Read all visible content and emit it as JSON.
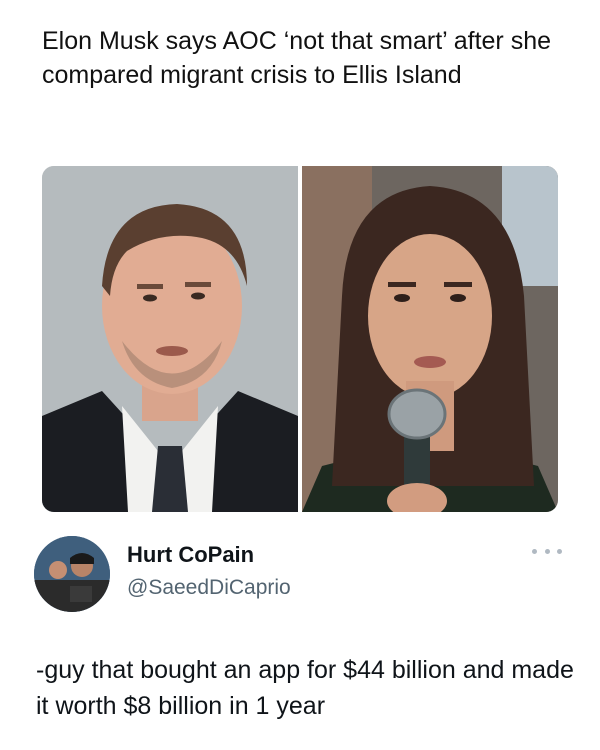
{
  "headline": "Elon Musk says AOC ‘not that smart’ after she compared migrant crisis to Ellis Island",
  "tweet": {
    "display_name": "Hurt CoPain",
    "handle": "@SaeedDiCaprio",
    "more_icon": "more-horizontal-icon",
    "text": "-guy that bought an app for $44 billion and made it worth $8 billion in 1 year"
  },
  "colors": {
    "text": "#0f1419",
    "secondary_text": "#536471",
    "background": "#ffffff"
  }
}
